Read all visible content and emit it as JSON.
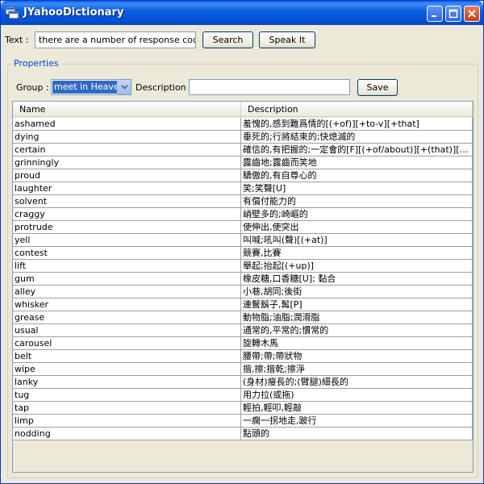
{
  "window": {
    "title": "JYahooDictionary"
  },
  "toolbar": {
    "text_label": "Text :",
    "text_value": "there are a number of response codes i",
    "search_label": "Search",
    "speak_label": "Speak It"
  },
  "properties": {
    "title": "Properties",
    "group_label": "Group :",
    "group_value": "meet in Heaven",
    "description_label": "Description :",
    "description_value": "",
    "save_label": "Save"
  },
  "table": {
    "columns": [
      "Name",
      "Description"
    ],
    "rows": [
      {
        "name": "ashamed",
        "desc": "羞愧的,感到難爲情的[(+of)][+to-v][+that]"
      },
      {
        "name": "dying",
        "desc": "垂死的;行將結束的;快熄滅的"
      },
      {
        "name": "certain",
        "desc": "確信的,有把握的;一定會的[F][(+of/about)][+(that)][+..."
      },
      {
        "name": "grinningly",
        "desc": "露齒地;露齒而笑地"
      },
      {
        "name": "proud",
        "desc": "驕傲的,有自尊心的"
      },
      {
        "name": "laughter",
        "desc": "笑;笑聲[U]"
      },
      {
        "name": "solvent",
        "desc": "有償付能力的"
      },
      {
        "name": "craggy",
        "desc": "峭壁多的;崎嶇的"
      },
      {
        "name": "protrude",
        "desc": " 使伸出,使突出"
      },
      {
        "name": "yell",
        "desc": "叫喊;吼叫(聲)[(+at)]"
      },
      {
        "name": "contest",
        "desc": "競賽,比賽"
      },
      {
        "name": "lift",
        "desc": "舉起;抬起[(+up)]"
      },
      {
        "name": "gum",
        "desc": "橡皮糖,口香糖[U]; 黏合"
      },
      {
        "name": "alley",
        "desc": "小巷,胡同;後街"
      },
      {
        "name": "whisker",
        "desc": "連鬢鬍子,髯[P]"
      },
      {
        "name": "grease",
        "desc": " 動物脂;油脂;潤滑脂"
      },
      {
        "name": "usual",
        "desc": "通常的,平常的;慣常的"
      },
      {
        "name": "carousel",
        "desc": "旋轉木馬"
      },
      {
        "name": "belt",
        "desc": "腰帶;帶;帶狀物"
      },
      {
        "name": "wipe",
        "desc": "揩,擦;揩乾;擦淨"
      },
      {
        "name": "lanky",
        "desc": "(身材)瘦長的;(臂腿)細長的"
      },
      {
        "name": "tug",
        "desc": "用力拉(或拖)"
      },
      {
        "name": "tap",
        "desc": "輕拍,輕叩,輕敲"
      },
      {
        "name": "limp",
        "desc": "一瘸一拐地走,跛行"
      },
      {
        "name": "nodding",
        "desc": "點頭的"
      }
    ]
  }
}
